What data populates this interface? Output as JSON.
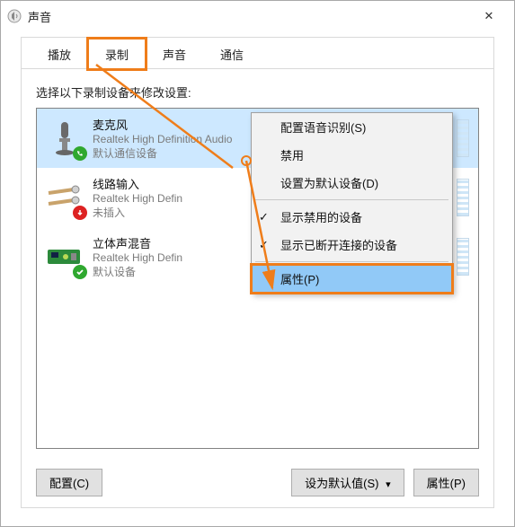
{
  "window": {
    "title": "声音",
    "close_glyph": "✕"
  },
  "tabs": {
    "play": "播放",
    "record": "录制",
    "sound": "声音",
    "comm": "通信"
  },
  "instruction": "选择以下录制设备来修改设置:",
  "devices": [
    {
      "name": "麦克风",
      "sub": "Realtek High Definition Audio",
      "status": "默认通信设备",
      "badge": "green-phone"
    },
    {
      "name": "线路输入",
      "sub": "Realtek High Defin",
      "status": "未插入",
      "badge": "red-down"
    },
    {
      "name": "立体声混音",
      "sub": "Realtek High Defin",
      "status": "默认设备",
      "badge": "green-check"
    }
  ],
  "context_menu": {
    "items": [
      "配置语音识别(S)",
      "禁用",
      "设置为默认设备(D)"
    ],
    "checked_items": [
      "显示禁用的设备",
      "显示已断开连接的设备"
    ],
    "selected": "属性(P)"
  },
  "buttons": {
    "config": "配置(C)",
    "set_default": "设为默认值(S)",
    "properties": "属性(P)"
  }
}
